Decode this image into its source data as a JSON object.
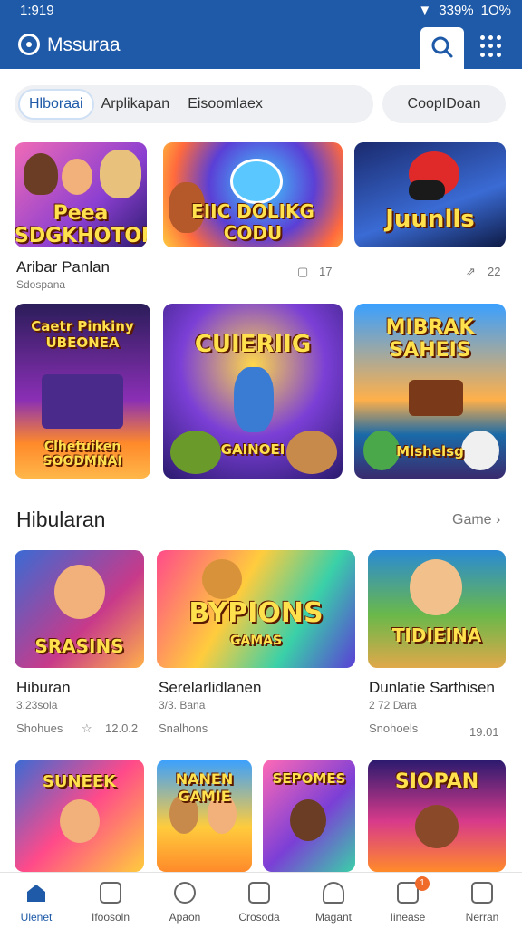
{
  "status_bar": {
    "time": "1:919",
    "battery": "339%",
    "signal": "1O%"
  },
  "app_bar": {
    "title": "Mssuraa",
    "search_icon": "search-icon",
    "menu_icon": "grid-menu-icon"
  },
  "filter_tabs": [
    "Hlboraai",
    "Arplikapan",
    "Eisoomlaex"
  ],
  "filter_chip": "CoopIDoan",
  "row1": [
    {
      "title": "Peea SDGKHOTON",
      "subtitle": "SDGKHOTON",
      "caption": "Aribar Panlan",
      "sub": "Sdospana",
      "meta": "17"
    },
    {
      "title": "EIIC DOLIKG CODU",
      "subtitle": "DOLIKG CODU",
      "caption": "",
      "sub": "",
      "meta": ""
    },
    {
      "title": "Juunlls",
      "subtitle": "",
      "caption": "",
      "sub": "",
      "meta": "22"
    }
  ],
  "row2": [
    {
      "title": "Caetr Pinkiny UBEONEA",
      "bottom": "Clhetuiken SOODMNAI"
    },
    {
      "title": "CUIERIIG",
      "bottom": "GAINOEI"
    },
    {
      "title": "MIBRAK SAHEIS",
      "bottom": "Mlshelsg"
    }
  ],
  "section": {
    "title": "Hibularan",
    "more_label": "Game"
  },
  "row3": [
    {
      "title": "SRASINS",
      "caption": "Hiburan",
      "sub": "3.23sola",
      "meta": "Shohues",
      "meta2": "12.0.2"
    },
    {
      "title": "BYPIONS",
      "subtitle": "GAMAS",
      "caption": "Serelarlidlanen",
      "sub": "3/3. Bana",
      "meta": "Snalhons",
      "meta2": ""
    },
    {
      "title": "TIDIEINA",
      "caption": "Dunlatie Sarthisen",
      "sub": "2 72 Dara",
      "meta": "Snohoels",
      "meta2": "19.01"
    }
  ],
  "row4": [
    {
      "title": "SUNEEK"
    },
    {
      "title": "NANEN GAMIE"
    },
    {
      "title": "SEPOMES"
    },
    {
      "title": "SIOPAN"
    }
  ],
  "bottom_nav": [
    {
      "label": "Ulenet",
      "icon": "home-icon"
    },
    {
      "label": "Ifoosoln",
      "icon": "briefcase-icon"
    },
    {
      "label": "Apaon",
      "icon": "compass-icon"
    },
    {
      "label": "Crosoda",
      "icon": "check-box-icon"
    },
    {
      "label": "Magant",
      "icon": "person-icon"
    },
    {
      "label": "Iinease",
      "icon": "apps-icon",
      "badge": "1"
    },
    {
      "label": "Nerran",
      "icon": "stack-icon"
    }
  ],
  "colors": {
    "primary": "#1e5aa8",
    "badge": "#f06a2a"
  }
}
